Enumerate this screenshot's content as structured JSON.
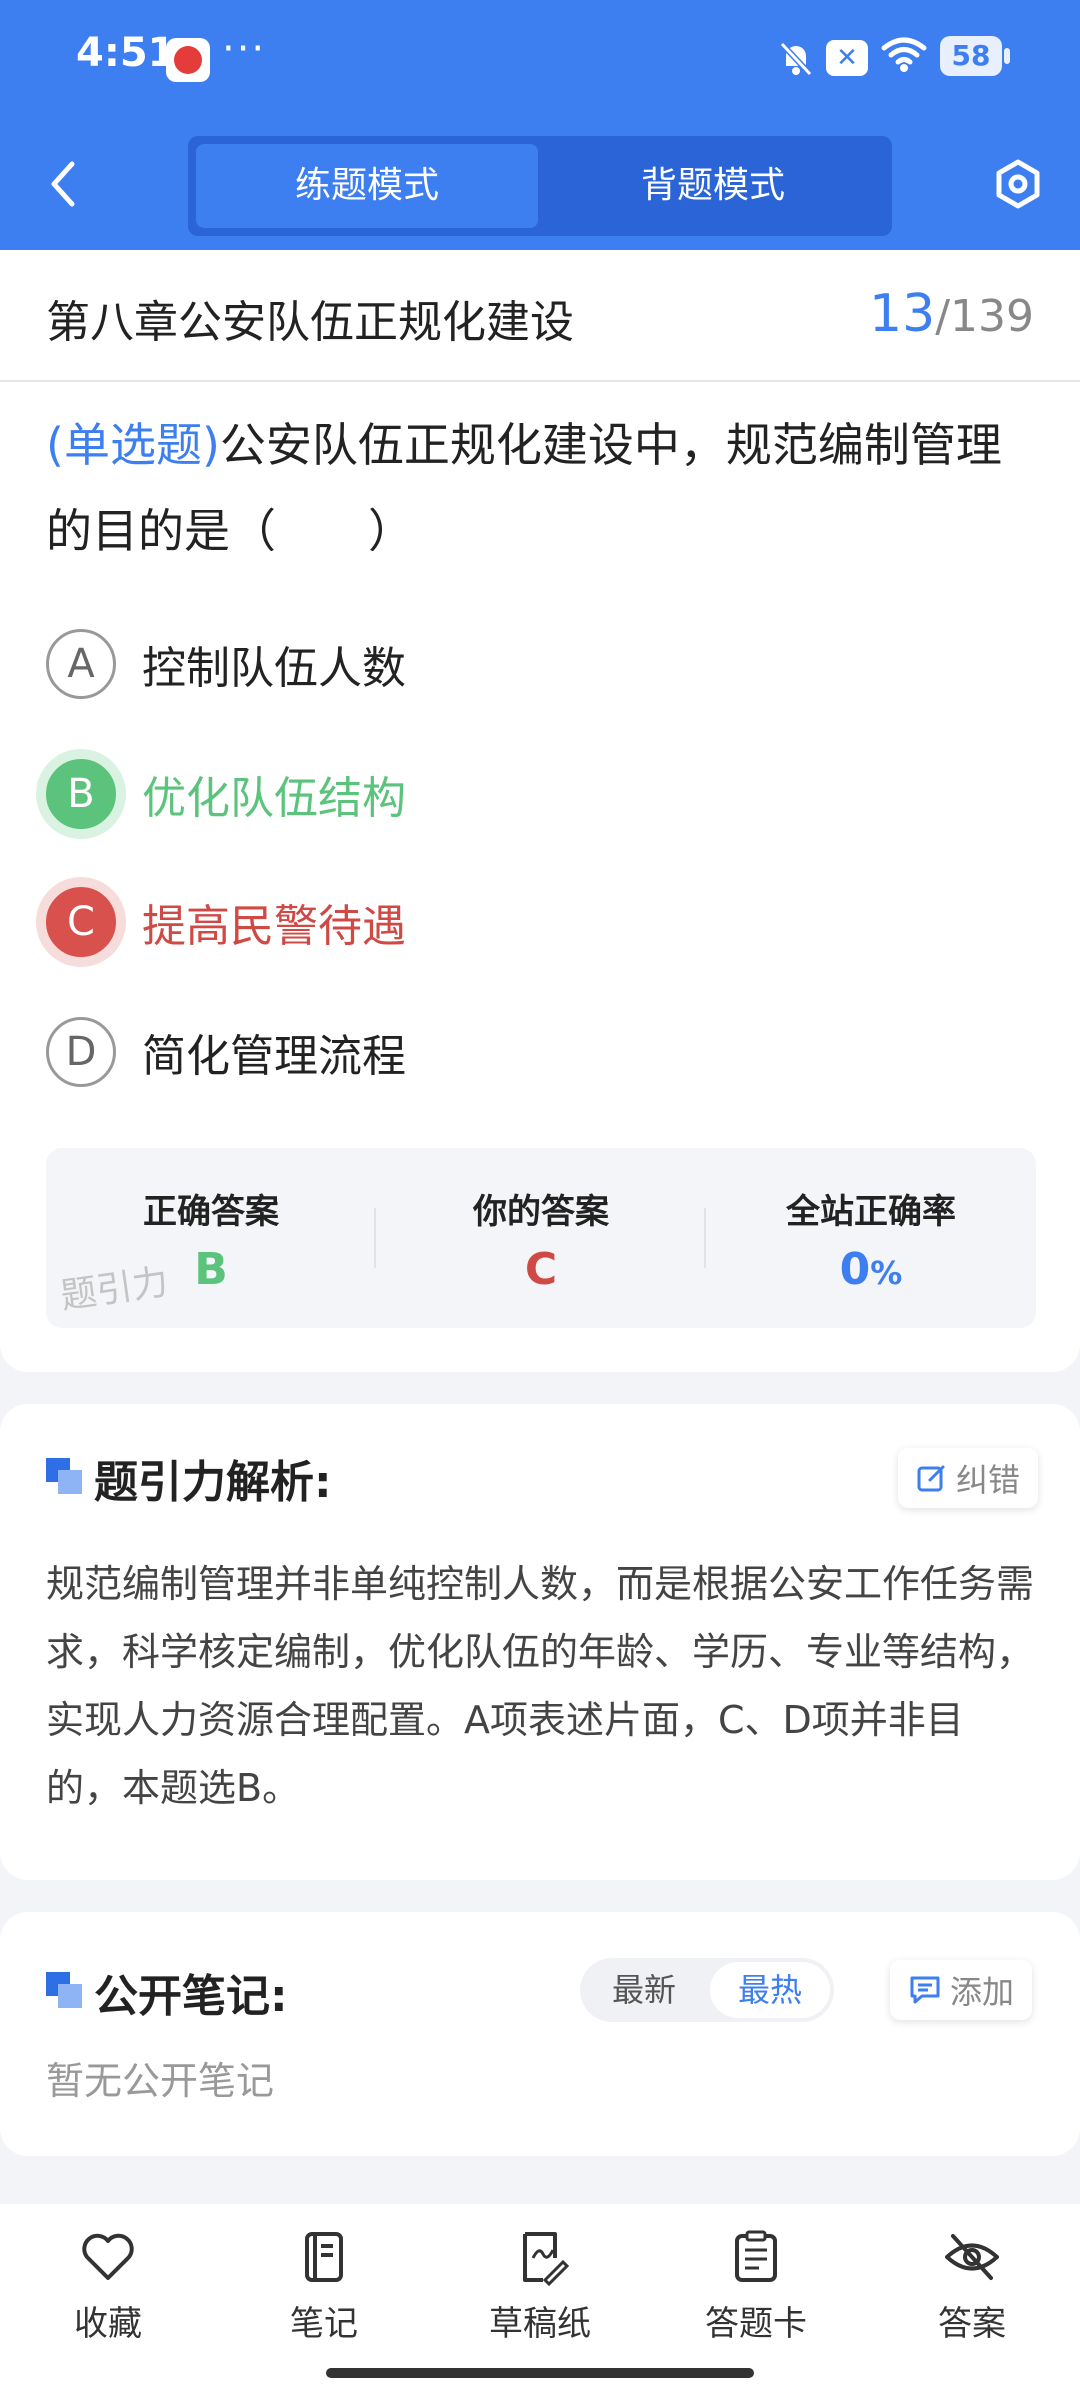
{
  "status_bar": {
    "time": "4:51",
    "dots": "···",
    "battery": "58",
    "icons": [
      "app-badge-icon",
      "bell-muted-icon",
      "x-box-icon",
      "wifi-icon",
      "battery-icon"
    ]
  },
  "nav": {
    "back_icon": "chevron-left-icon",
    "mode_practice": "练题模式",
    "mode_memorize": "背题模式",
    "settings_icon": "hexagon-settings-icon"
  },
  "title_bar": {
    "chapter": "第八章公安队伍正规化建设",
    "current": "13",
    "separator": "/",
    "total": "139"
  },
  "question": {
    "type_label": "(单选题)",
    "text": "公安队伍正规化建设中，规范编制管理的目的是（　　）",
    "options": [
      {
        "letter": "A",
        "text": "控制队伍人数",
        "state": "normal"
      },
      {
        "letter": "B",
        "text": "优化队伍结构",
        "state": "correct"
      },
      {
        "letter": "C",
        "text": "提高民警待遇",
        "state": "wrong"
      },
      {
        "letter": "D",
        "text": "简化管理流程",
        "state": "normal"
      }
    ]
  },
  "answers": {
    "correct_label": "正确答案",
    "correct_value": "B",
    "yours_label": "你的答案",
    "yours_value": "C",
    "rate_label": "全站正确率",
    "rate_value": "0",
    "rate_unit": "%",
    "watermark": "题引力"
  },
  "analysis": {
    "title": "题引力解析:",
    "correct_button": "纠错",
    "text": "规范编制管理并非单纯控制人数，而是根据公安工作任务需求，科学核定编制，优化队伍的年龄、学历、专业等结构，实现人力资源合理配置。A项表述片面，C、D项并非目的，本题选B。"
  },
  "notes": {
    "title": "公开笔记:",
    "sort_latest": "最新",
    "sort_hot": "最热",
    "add_button": "添加",
    "empty_text": "暂无公开笔记"
  },
  "toolbar": {
    "items": [
      {
        "label": "收藏",
        "icon": "heart-icon"
      },
      {
        "label": "笔记",
        "icon": "notebook-icon"
      },
      {
        "label": "草稿纸",
        "icon": "draft-paper-icon"
      },
      {
        "label": "答题卡",
        "icon": "answer-card-icon"
      },
      {
        "label": "答案",
        "icon": "eye-off-icon"
      }
    ]
  },
  "colors": {
    "primary": "#3d7ef0",
    "correct": "#5bc37b",
    "wrong": "#d9514d"
  }
}
